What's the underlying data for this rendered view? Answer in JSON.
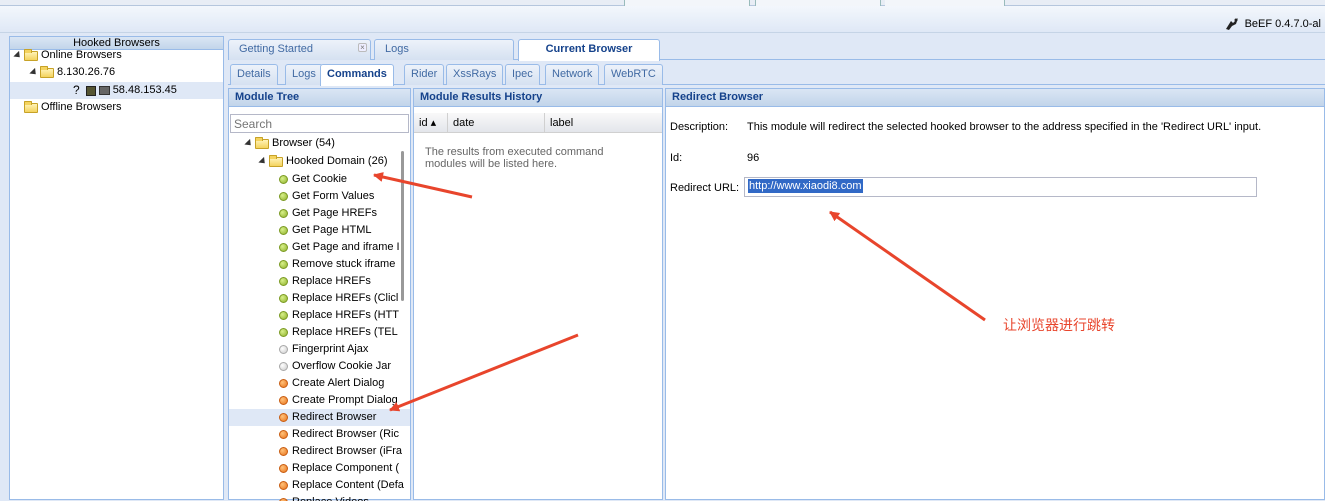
{
  "app": {
    "name_version": "BeEF  0.4.7.0-al"
  },
  "hooked_panel": {
    "title": "Hooked Browsers",
    "online_label": "Online Browsers",
    "server_ip": "8.130.26.76",
    "client_ip": "58.48.153.45",
    "unknown_mark": "?",
    "offline_label": "Offline Browsers"
  },
  "main_tabs": [
    "Getting Started",
    "Logs",
    "Current Browser"
  ],
  "sub_tabs": [
    "Details",
    "Logs",
    "Commands",
    "Rider",
    "XssRays",
    "Ipec",
    "Network",
    "WebRTC"
  ],
  "module_tree": {
    "title": "Module Tree",
    "search_placeholder": "Search",
    "root": "Browser (54)",
    "domain": "Hooked Domain (26)",
    "items": [
      {
        "label": "Get Cookie",
        "status": "green"
      },
      {
        "label": "Get Form Values",
        "status": "green"
      },
      {
        "label": "Get Page HREFs",
        "status": "green"
      },
      {
        "label": "Get Page HTML",
        "status": "green"
      },
      {
        "label": "Get Page and iframe I",
        "status": "green"
      },
      {
        "label": "Remove stuck iframe",
        "status": "green"
      },
      {
        "label": "Replace HREFs",
        "status": "green"
      },
      {
        "label": "Replace HREFs (Clicl",
        "status": "green"
      },
      {
        "label": "Replace HREFs (HTT",
        "status": "green"
      },
      {
        "label": "Replace HREFs (TEL",
        "status": "green"
      },
      {
        "label": "Fingerprint Ajax",
        "status": "grey"
      },
      {
        "label": "Overflow Cookie Jar",
        "status": "grey"
      },
      {
        "label": "Create Alert Dialog",
        "status": "orange"
      },
      {
        "label": "Create Prompt Dialog",
        "status": "orange"
      },
      {
        "label": "Redirect Browser",
        "status": "orange"
      },
      {
        "label": "Redirect Browser (Ric",
        "status": "orange"
      },
      {
        "label": "Redirect Browser (iFra",
        "status": "orange"
      },
      {
        "label": "Replace Component (",
        "status": "orange"
      },
      {
        "label": "Replace Content (Defa",
        "status": "orange"
      },
      {
        "label": "Replace Videos",
        "status": "orange"
      }
    ]
  },
  "results": {
    "title": "Module Results History",
    "col_id": "id ▴",
    "col_date": "date",
    "col_label": "label",
    "empty_text": "The results from executed command modules will be listed here."
  },
  "redirect": {
    "title": "Redirect Browser",
    "desc_label": "Description:",
    "desc_text": "This module will redirect the selected hooked browser to the address specified in the 'Redirect URL' input.",
    "id_label": "Id:",
    "id_value": "96",
    "url_label": "Redirect URL:",
    "url_value": "http://www.xiaodi8.com"
  },
  "annotation": {
    "text": "让浏览器进行跳转",
    "color": "#e8452c"
  }
}
